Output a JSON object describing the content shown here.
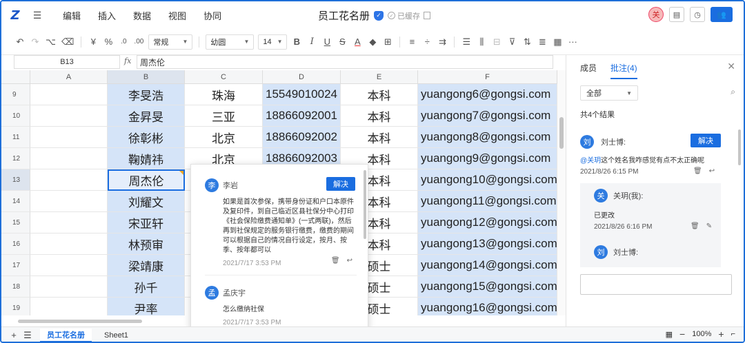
{
  "app": {
    "logo": "Z",
    "menu": [
      "编辑",
      "插入",
      "数据",
      "视图",
      "协同"
    ],
    "title": "员工花名册",
    "saved_status": "已缓存",
    "avatar_initial": "关"
  },
  "toolbar": {
    "currency": "¥",
    "percent": "%",
    "format_select": "常规",
    "font_select": "幼圆",
    "size_select": "14",
    "bold": "B",
    "italic": "I",
    "underline": "U",
    "strike": "S",
    "font_color": "A",
    "more": "···"
  },
  "formula": {
    "cell_ref": "B13",
    "fx": "fx",
    "value": "周杰伦"
  },
  "grid": {
    "columns": [
      "A",
      "B",
      "C",
      "D",
      "E",
      "F"
    ],
    "rows": [
      {
        "num": "9",
        "b": "李旻浩",
        "c": "珠海",
        "d": "15549010024",
        "e": "本科",
        "f": "yuangong6@gongsi.com"
      },
      {
        "num": "10",
        "b": "金昇旻",
        "c": "三亚",
        "d": "18866092001",
        "e": "本科",
        "f": "yuangong7@gongsi.com"
      },
      {
        "num": "11",
        "b": "徐彰彬",
        "c": "北京",
        "d": "18866092002",
        "e": "本科",
        "f": "yuangong8@gongsi.com"
      },
      {
        "num": "12",
        "b": "鞠婧祎",
        "c": "北京",
        "d": "18866092003",
        "e": "本科",
        "f": "yuangong9@gongsi.com"
      },
      {
        "num": "13",
        "b": "周杰伦",
        "c": "",
        "d": "",
        "e": "本科",
        "f": "yuangong10@gongsi.com"
      },
      {
        "num": "14",
        "b": "刘耀文",
        "c": "",
        "d": "",
        "e": "本科",
        "f": "yuangong11@gongsi.com"
      },
      {
        "num": "15",
        "b": "宋亚轩",
        "c": "",
        "d": "",
        "e": "本科",
        "f": "yuangong12@gongsi.com"
      },
      {
        "num": "16",
        "b": "林预审",
        "c": "",
        "d": "",
        "e": "本科",
        "f": "yuangong13@gongsi.com"
      },
      {
        "num": "17",
        "b": "梁靖康",
        "c": "",
        "d": "",
        "e": "硕士",
        "f": "yuangong14@gongsi.com"
      },
      {
        "num": "18",
        "b": "孙千",
        "c": "",
        "d": "",
        "e": "硕士",
        "f": "yuangong15@gongsi.com"
      },
      {
        "num": "19",
        "b": "尹率",
        "c": "",
        "d": "",
        "e": "硕士",
        "f": "yuangong16@gongsi.com"
      }
    ]
  },
  "popup": {
    "c1_avatar": "李",
    "c1_name": "李岩",
    "c1_resolve": "解决",
    "c1_text": "如果是首次参保，携带身份证和户口本原件及复印件，到自己临近区县社保分中心打印《社会保险缴费通知单》(一式两联)，然后再到社保规定的服务银行缴费，缴费的期间可以根据自己的情况自行设定，按月、按季、按年都可以",
    "c1_time": "2021/7/17 3:53 PM",
    "c2_avatar": "孟",
    "c2_name": "孟庆宇",
    "c2_text": "怎么缴纳社保",
    "c2_time": "2021/7/17 3:53 PM"
  },
  "panel": {
    "tab_members": "成员",
    "tab_comments": "批注(4)",
    "filter": "全部",
    "count": "共4个结果",
    "t1_avatar": "刘",
    "t1_name": "刘士博:",
    "t1_resolve": "解决",
    "t1_mention": "@关玥",
    "t1_text": "这个姓名我咋感觉有点不太正确呢",
    "t1_time": "2021/8/26 6:15 PM",
    "r1_avatar": "关",
    "r1_name": "关玥(我):",
    "r1_text": "已更改",
    "r1_time": "2021/8/26 6:16 PM",
    "r2_avatar": "刘",
    "r2_name": "刘士博:"
  },
  "bottom": {
    "sheet_active": "员工花名册",
    "sheet_other": "Sheet1",
    "zoom": "100%"
  }
}
